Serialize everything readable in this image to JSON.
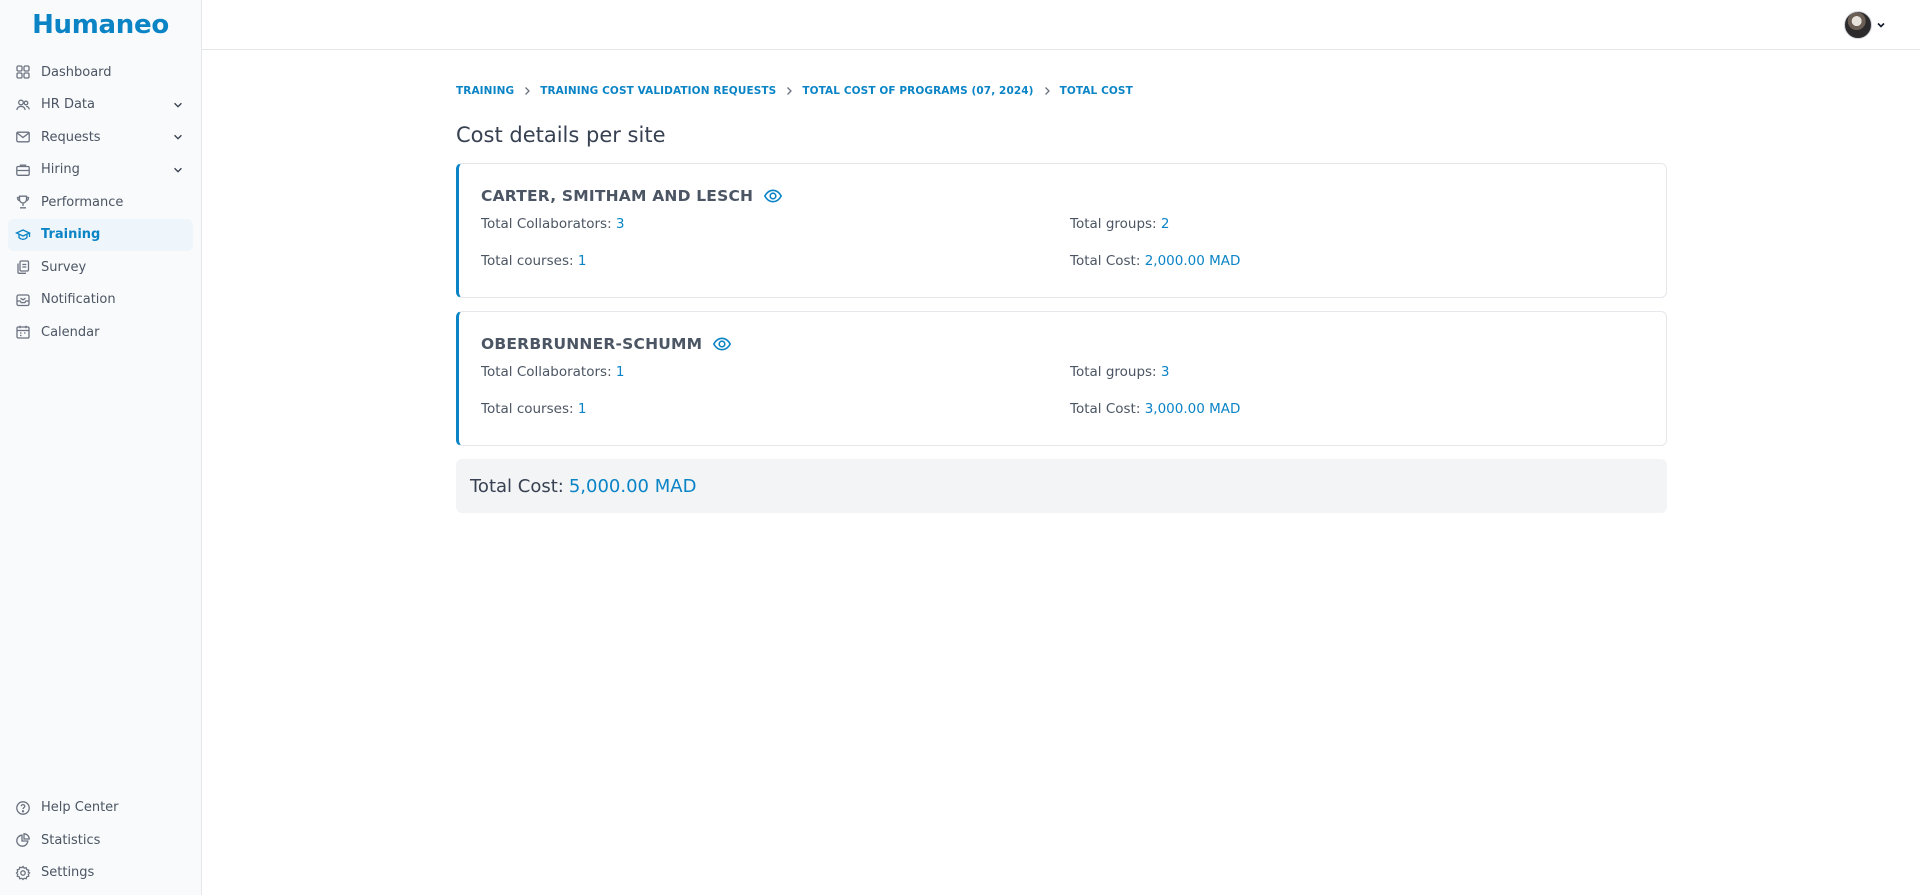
{
  "app": {
    "logo": "Humaneo"
  },
  "sidebar": {
    "items": [
      {
        "label": "Dashboard",
        "icon": "dashboard-icon"
      },
      {
        "label": "HR Data",
        "icon": "users-icon",
        "expandable": true
      },
      {
        "label": "Requests",
        "icon": "mail-icon",
        "expandable": true
      },
      {
        "label": "Hiring",
        "icon": "briefcase-icon",
        "expandable": true
      },
      {
        "label": "Performance",
        "icon": "trophy-icon"
      },
      {
        "label": "Training",
        "icon": "graduation-cap-icon",
        "active": true
      },
      {
        "label": "Survey",
        "icon": "clipboard-icon"
      },
      {
        "label": "Notification",
        "icon": "inbox-icon"
      },
      {
        "label": "Calendar",
        "icon": "calendar-icon"
      }
    ],
    "bottom_items": [
      {
        "label": "Help Center",
        "icon": "help-circle-icon"
      },
      {
        "label": "Statistics",
        "icon": "pie-chart-icon"
      },
      {
        "label": "Settings",
        "icon": "gear-icon"
      }
    ]
  },
  "breadcrumb": [
    "TRAINING",
    "TRAINING COST VALIDATION REQUESTS",
    "TOTAL COST OF PROGRAMS (07, 2024)",
    "TOTAL COST"
  ],
  "page": {
    "title": "Cost details per site"
  },
  "sites": [
    {
      "name": "CARTER, SMITHAM AND LESCH",
      "collaborators_label": "Total Collaborators:",
      "collaborators": "3",
      "groups_label": "Total groups:",
      "groups": "2",
      "courses_label": "Total courses:",
      "courses": "1",
      "cost_label": "Total Cost:",
      "cost": "2,000.00 MAD"
    },
    {
      "name": "OBERBRUNNER-SCHUMM",
      "collaborators_label": "Total Collaborators:",
      "collaborators": "1",
      "groups_label": "Total groups:",
      "groups": "3",
      "courses_label": "Total courses:",
      "courses": "1",
      "cost_label": "Total Cost:",
      "cost": "3,000.00 MAD"
    }
  ],
  "summary": {
    "label": "Total Cost:",
    "value": "5,000.00 MAD"
  },
  "colors": {
    "accent": "#0b84c6",
    "text": "#374151",
    "sidebar_bg": "#f9fafb",
    "summary_bg": "#f3f4f6"
  }
}
